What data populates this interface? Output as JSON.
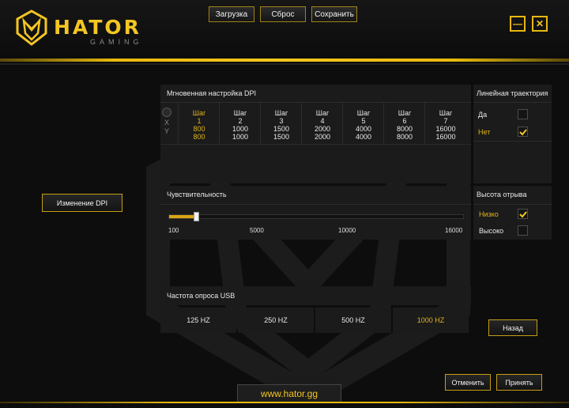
{
  "brand": {
    "logo_text": "HATOR",
    "logo_sub": "GAMING"
  },
  "toolbar": {
    "load_label": "Загрузка",
    "reset_label": "Сброс",
    "save_label": "Сохранить"
  },
  "window": {
    "minimize_glyph": "—",
    "close_glyph": "✕"
  },
  "left_menu": {
    "dpi_change_label": "Изменение DPI"
  },
  "dpi_panel": {
    "title": "Мгновенная настройка DPI",
    "axis_x": "X",
    "axis_y": "Y",
    "selected_step": 1,
    "steps": [
      {
        "label": "Шаг",
        "num": "1",
        "x": "800",
        "y": "800"
      },
      {
        "label": "Шаг",
        "num": "2",
        "x": "1000",
        "y": "1000"
      },
      {
        "label": "Шаг",
        "num": "3",
        "x": "1500",
        "y": "1500"
      },
      {
        "label": "Шаг",
        "num": "4",
        "x": "2000",
        "y": "2000"
      },
      {
        "label": "Шаг",
        "num": "5",
        "x": "4000",
        "y": "4000"
      },
      {
        "label": "Шаг",
        "num": "6",
        "x": "8000",
        "y": "8000"
      },
      {
        "label": "Шаг",
        "num": "7",
        "x": "16000",
        "y": "16000"
      }
    ]
  },
  "linear_panel": {
    "title": "Линейная траектория",
    "yes_label": "Да",
    "no_label": "Нет",
    "yes_checked": false,
    "no_checked": true
  },
  "sensitivity": {
    "title": "Чувствительность",
    "value": 800,
    "min": 100,
    "max": 16000,
    "ticks": [
      "100",
      "5000",
      "10000",
      "16000"
    ]
  },
  "lift_panel": {
    "title": "Высота отрыва",
    "low_label": "Низко",
    "high_label": "Высоко",
    "low_checked": true,
    "high_checked": false
  },
  "usb": {
    "title": "Частота опроса USB",
    "options": [
      "125 HZ",
      "250 HZ",
      "500 HZ",
      "1000 HZ"
    ],
    "selected": "1000 HZ"
  },
  "actions": {
    "back_label": "Назад",
    "cancel_label": "Отменить",
    "apply_label": "Принять"
  },
  "footer": {
    "url": "www.hator.gg"
  },
  "colors": {
    "accent": "#f3c622",
    "selected_text": "#e2b41a",
    "panel_bg": "#1b1b1b",
    "page_bg": "#0d0d0d"
  }
}
